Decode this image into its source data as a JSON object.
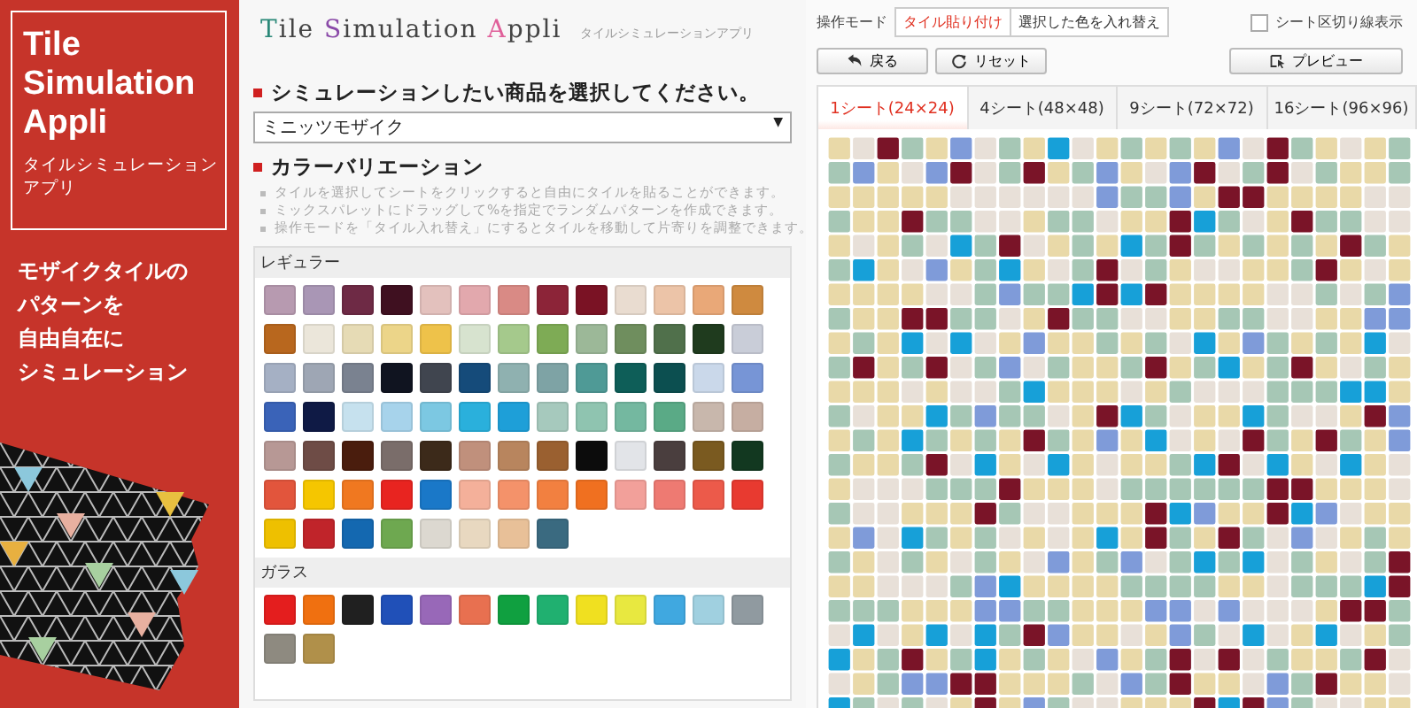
{
  "banner": {
    "title": "Tile Simulation Appli",
    "subtitle": "タイルシミュレーションアプリ",
    "tagline": [
      "モザイクタイルの",
      "パターンを",
      "自由自在に",
      "シミュレーション"
    ]
  },
  "header": {
    "title_parts": [
      {
        "text": "T",
        "color": "#2a8878"
      },
      {
        "text": "ile ",
        "color": "#444444"
      },
      {
        "text": "S",
        "color": "#8a4aa8"
      },
      {
        "text": "imulation ",
        "color": "#444444"
      },
      {
        "text": "A",
        "color": "#e0609a"
      },
      {
        "text": "ppli",
        "color": "#444444"
      }
    ],
    "subtitle": "タイルシミュレーションアプリ"
  },
  "product": {
    "heading": "シミュレーションしたい商品を選択してください。",
    "value": "ミニッツモザイク",
    "caret": "▼"
  },
  "colors": {
    "heading": "カラーバリエーション",
    "notes": [
      "タイルを選択してシートをクリックすると自由にタイルを貼ることができます。",
      "ミックスパレットにドラッグして%を指定でランダムパターンを作成できます。",
      "操作モードを「タイル入れ替え」にするとタイルを移動して片寄りを調整できます。"
    ],
    "groups": [
      {
        "label": "レギュラー",
        "swatches": [
          {
            "color": "#b79ab0"
          },
          {
            "color": "#a996b5"
          },
          {
            "color": "#6e2a45"
          },
          {
            "color": "#3f1020"
          },
          {
            "color": "#e3c1bd"
          },
          {
            "color": "#e2a8ad"
          },
          {
            "color": "#d98a85"
          },
          {
            "color": "#8c2438"
          },
          {
            "color": "#7a1224"
          },
          {
            "color": "#e9dcd0"
          },
          {
            "color": "#ecc4a8"
          },
          {
            "color": "#e9a878"
          },
          {
            "color": "#cf8a3f"
          },
          {
            "color": "#b8671e"
          },
          {
            "color": "#ebe6da"
          },
          {
            "color": "#e6dbb5"
          },
          {
            "color": "#ecd589"
          },
          {
            "color": "#eec24a"
          },
          {
            "color": "#d7e3cf"
          },
          {
            "color": "#a5c98c"
          },
          {
            "color": "#7eab55"
          },
          {
            "color": "#9cb898"
          },
          {
            "color": "#6f8e5e"
          },
          {
            "color": "#50704b"
          },
          {
            "color": "#1f3b1e"
          },
          {
            "color": "#c9cdd8"
          },
          {
            "color": "#a5b0c4"
          },
          {
            "color": "#9ea6b4"
          },
          {
            "color": "#7a8290"
          },
          {
            "color": "#101420"
          },
          {
            "color": "#40454f"
          },
          {
            "color": "#154b7a"
          },
          {
            "color": "#8fb1b0"
          },
          {
            "color": "#7ea3a5"
          },
          {
            "color": "#4f9a96"
          },
          {
            "color": "#0e5e58"
          },
          {
            "color": "#0c4f50"
          },
          {
            "color": "#cad8ea"
          },
          {
            "color": "#7795d6"
          },
          {
            "color": "#3a63b8"
          },
          {
            "color": "#0f1a45"
          },
          {
            "color": "#c6e1ee"
          },
          {
            "color": "#a7d3eb"
          },
          {
            "color": "#7cc8e2"
          },
          {
            "color": "#2ab0dc"
          },
          {
            "color": "#1e9fd8"
          },
          {
            "color": "#a6c9bd"
          },
          {
            "color": "#8fc4b0"
          },
          {
            "color": "#74b8a0"
          },
          {
            "color": "#5aaa86"
          },
          {
            "color": "#c8b7ac"
          },
          {
            "color": "#c6aea2"
          },
          {
            "color": "#b79895"
          },
          {
            "color": "#6e4c46"
          },
          {
            "color": "#4a1d0d"
          },
          {
            "color": "#7a6d6a"
          },
          {
            "color": "#3c2a1a"
          },
          {
            "color": "#c0907c"
          },
          {
            "color": "#b8855e"
          },
          {
            "color": "#9a6030"
          },
          {
            "color": "#0c0c0c"
          },
          {
            "color": "#e2e4e8"
          },
          {
            "color": "#4a3e3e"
          },
          {
            "color": "#7a5a20"
          },
          {
            "color": "#123820"
          },
          {
            "color": "#e2553c"
          },
          {
            "color": "#f5c600"
          },
          {
            "color": "#f07820"
          },
          {
            "color": "#e82420"
          },
          {
            "color": "#1a78c8"
          },
          {
            "color": "#f4b09a"
          },
          {
            "color": "#f4926a"
          },
          {
            "color": "#f28040"
          },
          {
            "color": "#f07020"
          },
          {
            "color": "#f2a09a"
          },
          {
            "color": "#ee7a72"
          },
          {
            "color": "#ec5a4a"
          },
          {
            "color": "#e83a30"
          },
          {
            "color": "#eec000"
          },
          {
            "color": "#c0242a"
          },
          {
            "color": "#1468b0"
          },
          {
            "color": "#6ea850"
          },
          {
            "color": "#dcd8d0"
          },
          {
            "color": "#e8d8c0"
          },
          {
            "color": "#e8c098"
          },
          {
            "color": "#3a6a80"
          }
        ]
      },
      {
        "label": "ガラス",
        "swatches": [
          {
            "color": "#e41e1e"
          },
          {
            "color": "#f07010"
          },
          {
            "color": "#202020"
          },
          {
            "color": "#2050b8"
          },
          {
            "color": "#9868b8"
          },
          {
            "color": "#e87050"
          },
          {
            "color": "#10a040"
          },
          {
            "color": "#20b070"
          },
          {
            "color": "#f0e020"
          },
          {
            "color": "#e8e840"
          },
          {
            "color": "#40a8e0"
          },
          {
            "color": "#a0d0e0"
          },
          {
            "color": "#909aa0"
          },
          {
            "color": "#8e8a80"
          },
          {
            "color": "#b0904a"
          }
        ]
      }
    ]
  },
  "toolbar": {
    "mode_label": "操作モード",
    "modes": [
      {
        "label": "タイル貼り付け",
        "selected": true
      },
      {
        "label": "選択した色を入れ替え",
        "selected": false
      }
    ],
    "grid_lines": {
      "label": "シート区切り線表示",
      "checked": false
    },
    "buttons": [
      {
        "kind": "back",
        "label": "戻る"
      },
      {
        "kind": "reset",
        "label": "リセット"
      },
      {
        "kind": "preview",
        "label": "プレビュー"
      }
    ]
  },
  "sheet_tabs": [
    {
      "label": "1シート(24×24)",
      "selected": true
    },
    {
      "label": "4シート(48×48)",
      "selected": false
    },
    {
      "label": "9シート(72×72)",
      "selected": false
    },
    {
      "label": "16シート(96×96)",
      "selected": false
    }
  ],
  "sheet": {
    "kind": "mosaic"
  }
}
